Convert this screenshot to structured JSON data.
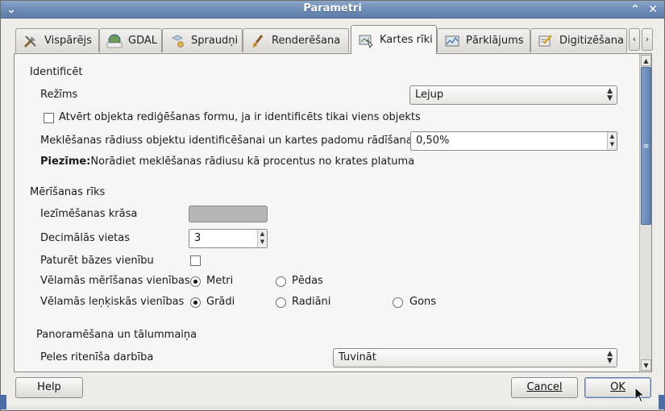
{
  "window": {
    "title": "Parametri"
  },
  "tabs": [
    {
      "label": "Vispārējs",
      "icon": "tools-icon",
      "active": false
    },
    {
      "label": "GDAL",
      "icon": "gdal-icon",
      "active": false
    },
    {
      "label": "Spraudņi",
      "icon": "plugins-icon",
      "active": false
    },
    {
      "label": "Renderēšana",
      "icon": "brush-icon",
      "active": false
    },
    {
      "label": "Kartes rīki",
      "icon": "map-tools-icon",
      "active": true
    },
    {
      "label": "Pārklājums",
      "icon": "overlay-icon",
      "active": false
    },
    {
      "label": "Digitizēšana",
      "icon": "digitize-icon",
      "active": false
    }
  ],
  "identify": {
    "section_label": "Identificēt",
    "mode_label": "Režīms",
    "mode_value": "Lejup",
    "open_form_label": "Atvērt objekta rediģēšanas formu, ja ir identificēts tikai viens objekts",
    "open_form_checked": false,
    "radius_label": "Meklēšanas rādiuss objektu identificēšanai un kartes padomu rādīšanai",
    "radius_value": "0,50%",
    "note_bold": "Piezīme:",
    "note_text": "Norādiet meklēšanas rādiusu kā procentus no krates platuma"
  },
  "measure": {
    "section_label": "Mērīšanas rīks",
    "rubberband_color_label": "Iezīmēšanas krāsa",
    "rubberband_color": "#b6b6b6",
    "decimals_label": "Decimālās vietas",
    "decimals_value": "3",
    "keep_base_unit_label": "Paturēt bāzes vienību",
    "keep_base_unit_checked": false,
    "units_label": "Vēlamās mērīšanas vienības",
    "units_options": [
      "Metri",
      "Pēdas"
    ],
    "units_selected": "Metri",
    "angle_units_label": "Vēlamās leņķiskās vienības",
    "angle_options": [
      "Grādi",
      "Radiāni",
      "Gons"
    ],
    "angle_selected": "Grādi"
  },
  "pan_zoom": {
    "section_label": "Panoramēšana un tālummaiņa",
    "wheel_action_label": "Peles ritenīša darbība",
    "wheel_action_value": "Tuvināt"
  },
  "buttons": {
    "help": "Help",
    "cancel": "Cancel",
    "ok": "OK"
  },
  "colors": {
    "titlebar": "#6d8cb6",
    "scroll_thumb": "#6b8cbc"
  }
}
